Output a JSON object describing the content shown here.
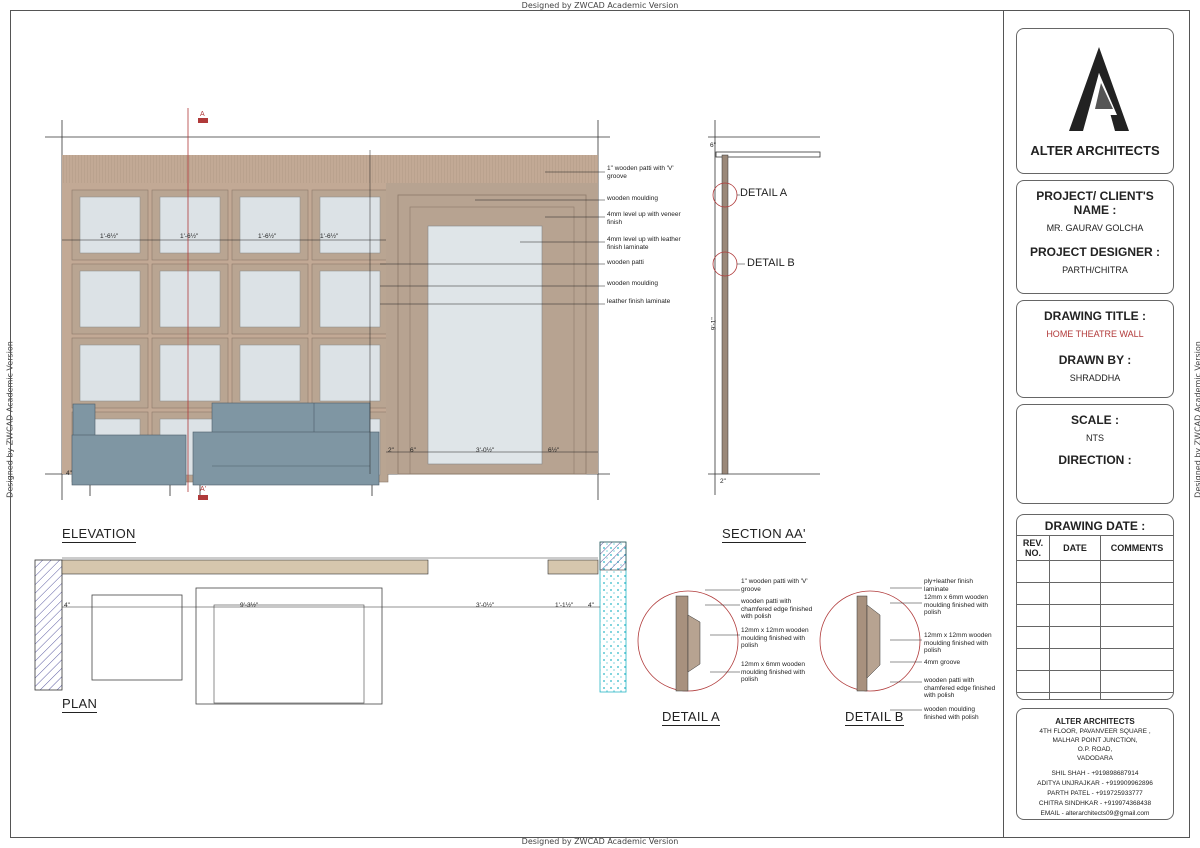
{
  "watermark": "Designed by ZWCAD Academic Version",
  "firm": {
    "name": "ALTER ARCHITECTS",
    "address": [
      "4TH FLOOR, PAVANVEER SQUARE ,",
      "MALHAR POINT JUNCTION,",
      "O.P. ROAD,",
      "VADODARA"
    ],
    "contacts": [
      "SHIL SHAH - +919898687914",
      "ADITYA UNJRAJKAR - +919909962896",
      "PARTH PATEL - +919725933777",
      "CHITRA SINDHKAR - +919974368438",
      "EMAIL - alterarchitects09@gmail.com"
    ]
  },
  "title_block": {
    "project_heading": "PROJECT/ CLIENT'S NAME :",
    "project_value": "MR. GAURAV GOLCHA",
    "designer_heading": "PROJECT DESIGNER :",
    "designer_value": "PARTH/CHITRA",
    "drawing_title_heading": "DRAWING TITLE :",
    "drawing_title_value": "HOME THEATRE WALL",
    "drawn_by_heading": "DRAWN BY :",
    "drawn_by_value": "SHRADDHA",
    "scale_heading": "SCALE :",
    "scale_value": "NTS",
    "direction_heading": "DIRECTION :",
    "drawing_date_heading": "DRAWING DATE :",
    "rev_no": "REV. NO.",
    "date": "DATE",
    "comments": "COMMENTS"
  },
  "views": {
    "elevation": "ELEVATION",
    "section": "SECTION AA'",
    "plan": "PLAN",
    "detail_a": "DETAIL A",
    "detail_b": "DETAIL B",
    "section_mark_a": "A",
    "section_mark_a2": "A'"
  },
  "elevation_notes": [
    "1\" wooden patti with 'V' groove",
    "wooden moulding",
    "4mm level up with veneer finish",
    "4mm level up with leather finish laminate",
    "wooden patti",
    "wooden moulding",
    "leather finish laminate"
  ],
  "elevation_dims": [
    "1'-6½\"",
    "1'-6½\"",
    "1'-6½\"",
    "1'-6½\"",
    "3'-0½\"",
    "6½\"",
    "4\"",
    "6\"",
    "2\""
  ],
  "section_dims": [
    "6\"",
    "9'-1\"",
    "2\""
  ],
  "plan_dims": [
    "4\"",
    "9'-3½\"",
    "3'-0½\"",
    "1'-1½\"",
    "4\""
  ],
  "detail_a_notes": [
    "1\" wooden patti with 'V' groove",
    "wooden patti with chamfered edge finished with polish",
    "12mm x 12mm wooden moulding finished with polish",
    "12mm x 6mm wooden moulding finished with polish"
  ],
  "detail_b_notes": [
    "ply+leather finish laminate",
    "12mm x 6mm wooden moulding finished with polish",
    "12mm x 12mm wooden moulding finished with polish",
    "4mm groove",
    "wooden patti with chamfered edge finished with polish",
    "wooden moulding finished with polish"
  ],
  "colors": {
    "wood": "#c2a995",
    "wood_dark": "#a8917e",
    "panel": "#dce2e6",
    "sofa": "#7f96a3",
    "section_red": "#b03a3a",
    "glass": "#2ab7c6"
  }
}
